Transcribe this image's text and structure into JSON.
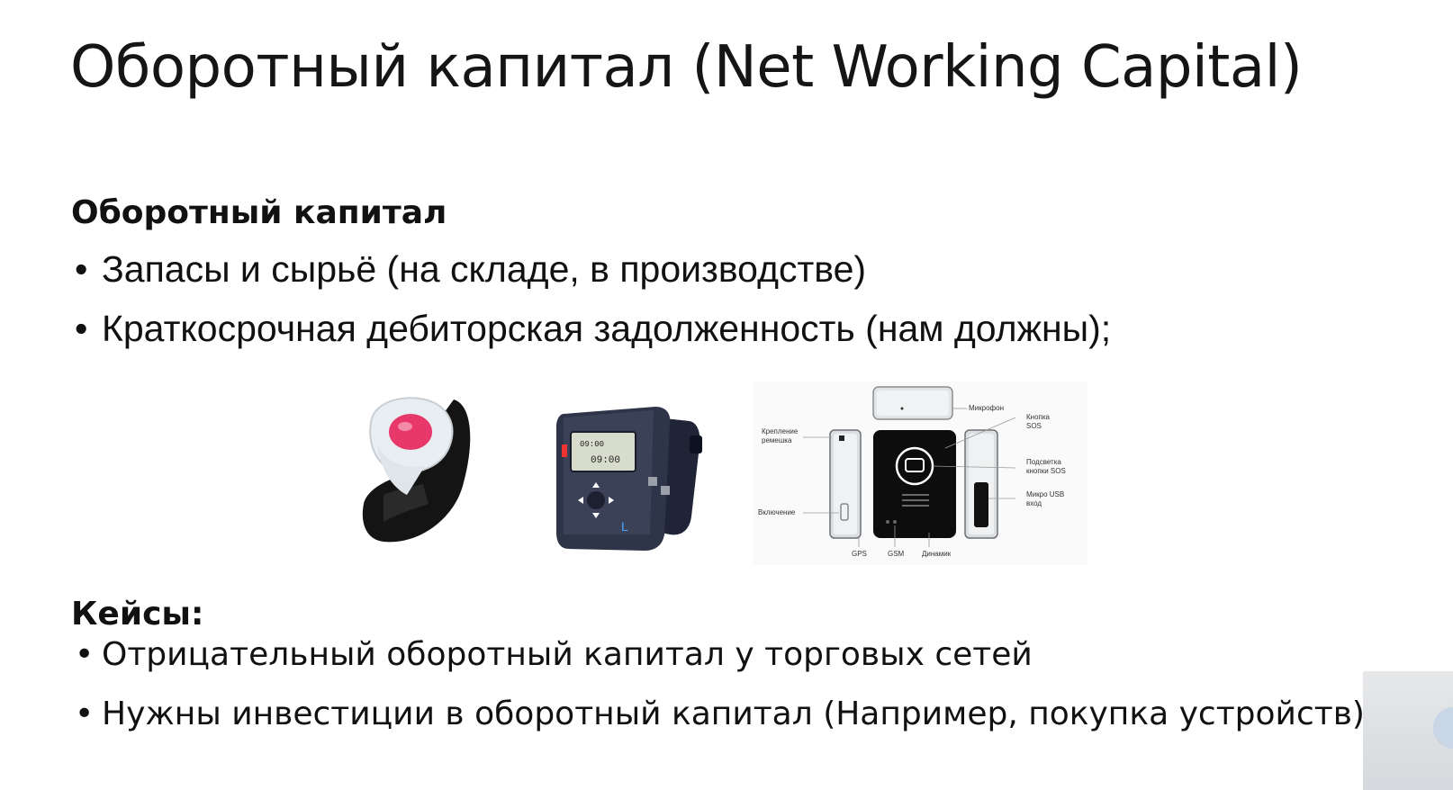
{
  "slide": {
    "title": "Оборотный капитал (Net Working Capital)",
    "section1": {
      "heading": "Оборотный капитал",
      "bullets": [
        "Запасы и сырьё (на складе, в производстве)",
        "Краткосрочная дебиторская задолженность (нам должны);"
      ]
    },
    "section2": {
      "heading": "Кейсы:",
      "bullets": [
        "Отрицательный оборотный капитал у торговых сетей",
        "Нужны инвестиции в оборотный капитал (Например, покупка устройств)"
      ]
    },
    "bullet_glyph": "•",
    "diagram_labels": {
      "microphone": "Микрофон",
      "sos_button_1": "Кнопка",
      "sos_button_2": "SOS",
      "strap_mount_1": "Крепление",
      "strap_mount_2": "ремешка",
      "sos_light_1": "Подсветка",
      "sos_light_2": "кнопки SOS",
      "usb_1": "Микро USB",
      "usb_2": "вход",
      "power": "Включение",
      "gps": "GPS",
      "gsm": "GSM",
      "speaker": "Динамик"
    },
    "watch_screen_1": "09:00",
    "watch_screen_2": "09:00"
  },
  "icons": {
    "image1": "sos-bracelet-image",
    "image2": "gps-watch-image",
    "image3": "device-diagram-image"
  },
  "colors": {
    "text": "#111111",
    "background": "#ffffff",
    "sos_button": "#e8386a"
  }
}
